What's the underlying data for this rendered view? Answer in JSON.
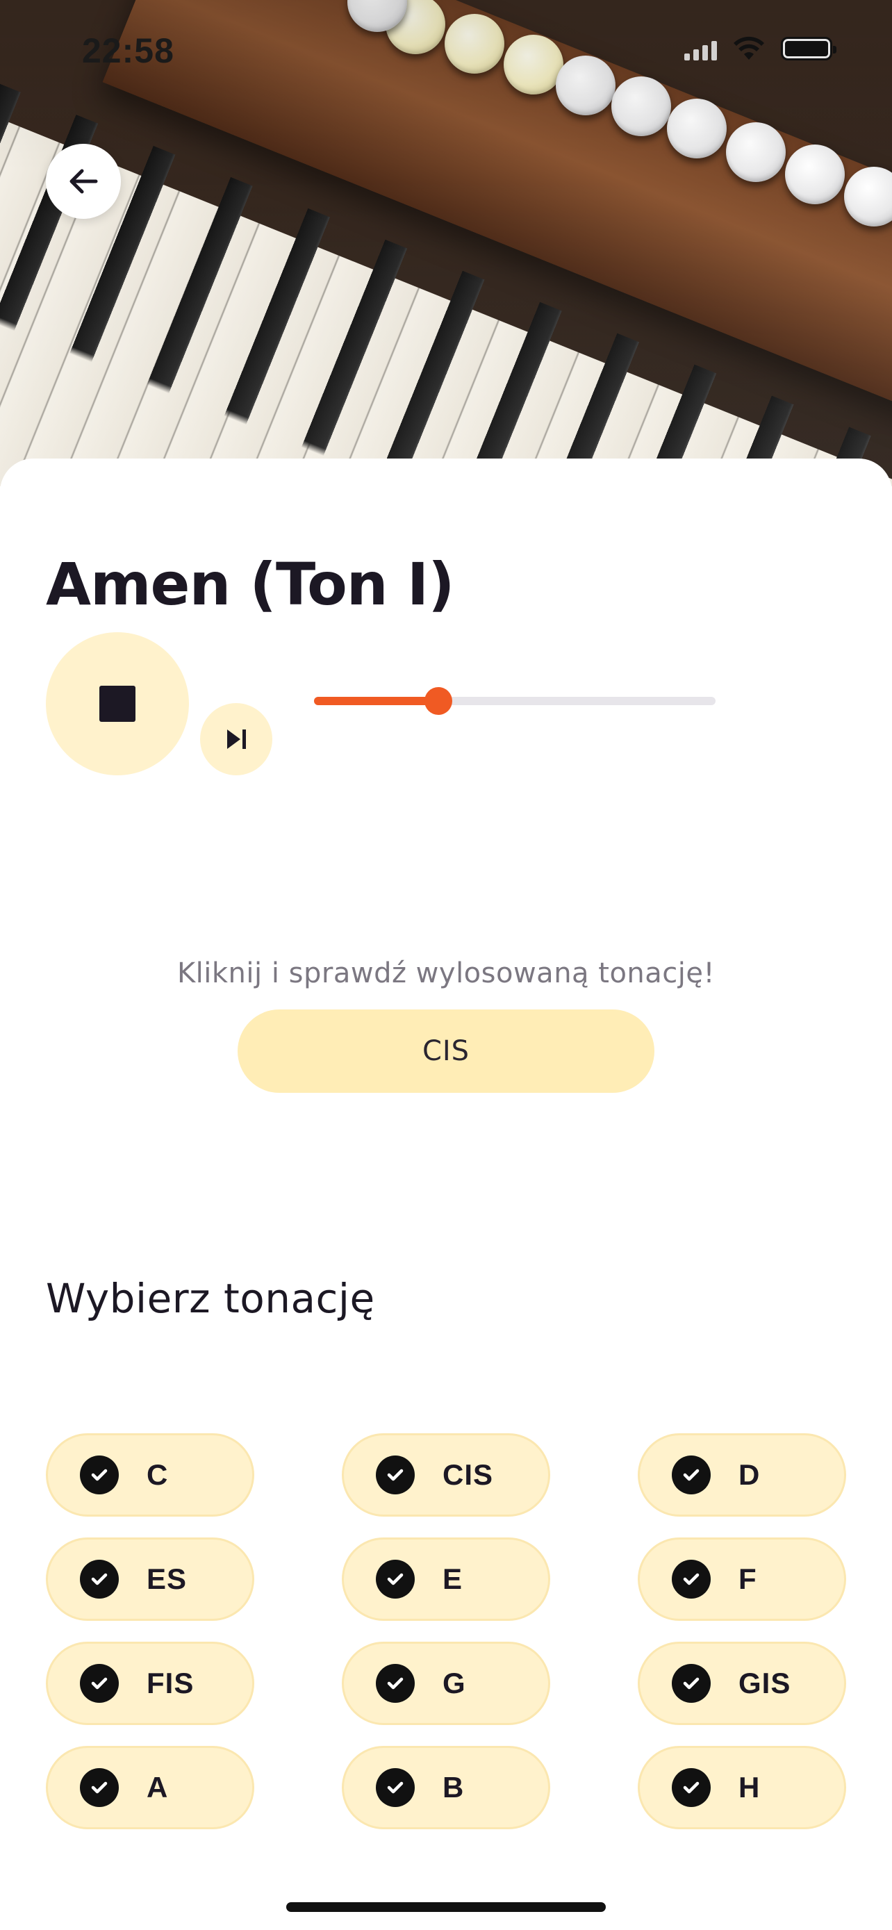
{
  "status_bar": {
    "time": "22:58"
  },
  "header": {
    "back_icon": "arrow-left-icon"
  },
  "player": {
    "title": "Amen (Ton I)",
    "stop_icon": "stop-icon",
    "next_icon": "skip-next-icon",
    "progress_fraction": 0.31,
    "accent_color": "#f05a23"
  },
  "reveal": {
    "hint": "Kliknij i sprawdź wylosowaną tonację!",
    "key": "CIS"
  },
  "key_selection": {
    "title": "Wybierz tonację",
    "keys": [
      {
        "label": "C",
        "checked": true
      },
      {
        "label": "CIS",
        "checked": true
      },
      {
        "label": "D",
        "checked": true
      },
      {
        "label": "ES",
        "checked": true
      },
      {
        "label": "E",
        "checked": true
      },
      {
        "label": "F",
        "checked": true
      },
      {
        "label": "FIS",
        "checked": true
      },
      {
        "label": "G",
        "checked": true
      },
      {
        "label": "GIS",
        "checked": true
      },
      {
        "label": "A",
        "checked": true
      },
      {
        "label": "B",
        "checked": true
      },
      {
        "label": "H",
        "checked": true
      }
    ]
  },
  "colors": {
    "chip_background": "#fff2cc",
    "reveal_background": "#ffedb6"
  }
}
